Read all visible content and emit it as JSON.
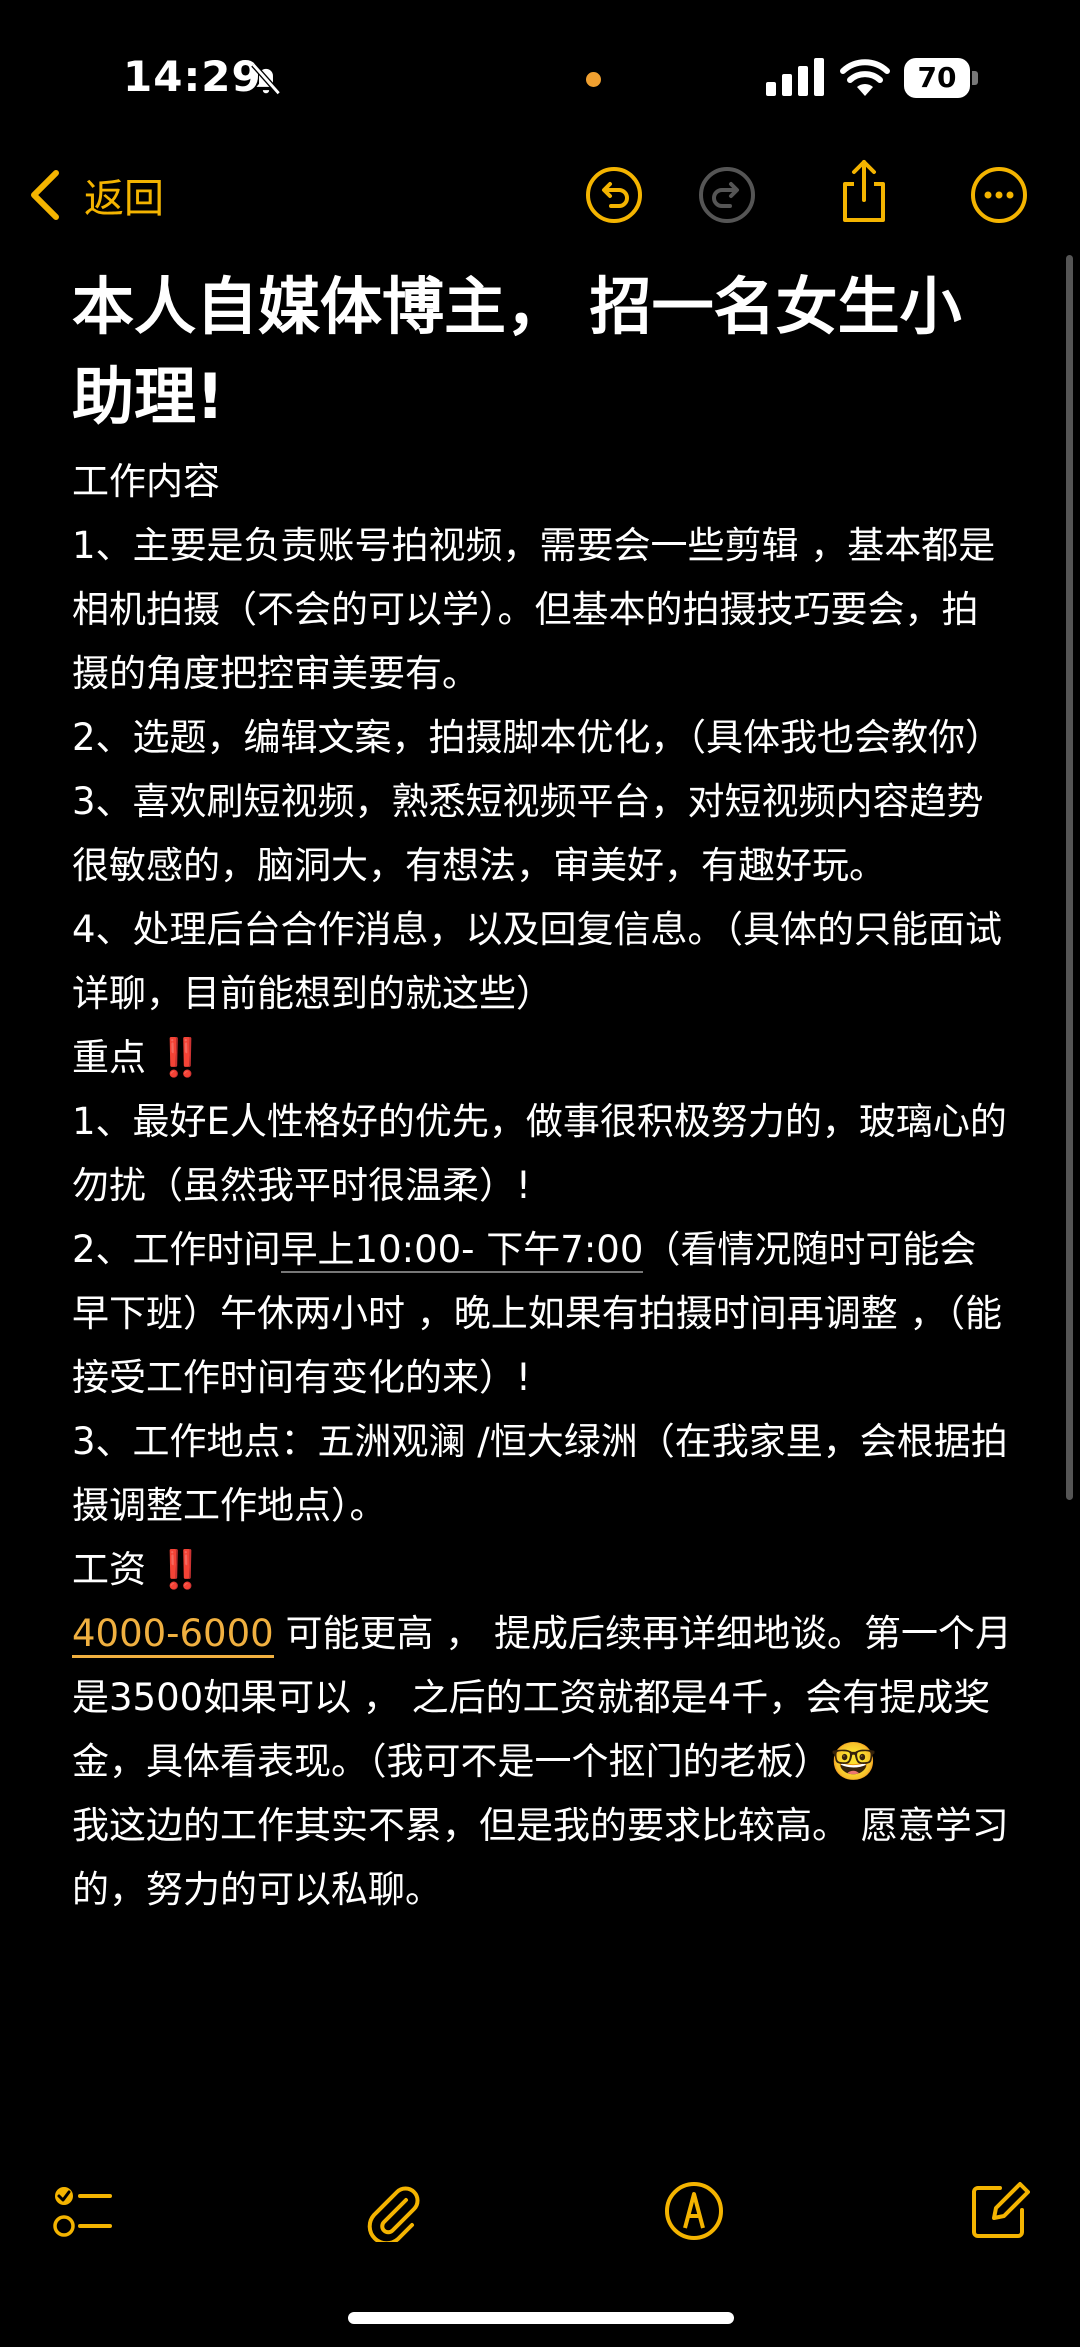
{
  "status_bar": {
    "time": "14:29",
    "battery": "70",
    "icons": [
      "bell-slash-icon",
      "orange-dot",
      "cellular-signal-icon",
      "wifi-icon",
      "battery-icon"
    ]
  },
  "nav": {
    "back_label": "返回",
    "accent_color": "#f4b400",
    "icons": [
      "undo-icon",
      "redo-icon",
      "share-icon",
      "more-icon"
    ]
  },
  "note": {
    "title": "本人自媒体博主， 招一名女生小助理!",
    "paragraphs": {
      "p0": " 工作内容",
      "p1": "1、主要是负责账号拍视频，需要会一些剪辑 ，基本都是相机拍摄（不会的可以学）。但基本的拍摄技巧要会，拍摄的角度把控审美要有。",
      "p2": "2、选题，编辑文案，拍摄脚本优化，（具体我也会教你）",
      "p3": " 3、喜欢刷短视频，熟悉短视频平台，对短视频内容趋势很敏感的，脑洞大，有想法，审美好，有趣好玩。",
      "p4": "4、处理后台合作消息，以及回复信息。（具体的只能面试详聊，目前能想到的就这些）",
      "p5_label": "重点 ",
      "p5_mark": "‼️",
      "p6": "1、最好E人性格好的优先，做事很积极努力的，玻璃心的勿扰（虽然我平时很温柔）!",
      "p7_pre": "2、工作时间",
      "p7_link": "早上10:00- 下午7:00",
      "p7_post": "（看情况随时可能会早下班）午休两小时 ，晚上如果有拍摄时间再调整 ，（能接受工作时间有变化的来）!",
      "p8": "3、工作地点：五洲观澜 /恒大绿洲（在我家里，会根据拍摄调整工作地点）。",
      "p9_label": "工资 ",
      "p9_mark": "‼️",
      "p10_link": "4000-6000",
      "p10_post": " 可能更高 ， 提成后续再详细地谈。第一个月是3500如果可以 ， 之后的工资就都是4千，会有提成奖金，具体看表现。（我可不是一个抠门的老板）🤓",
      "p11": "我这边的工作其实不累，但是我的要求比较高。 愿意学习的，努力的可以私聊。"
    }
  },
  "toolbar": {
    "icons": [
      "checklist-icon",
      "paperclip-icon",
      "pen-markup-icon",
      "compose-icon"
    ]
  }
}
